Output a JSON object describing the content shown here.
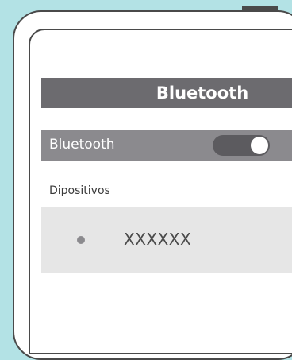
{
  "header": {
    "title": "Bluetooth"
  },
  "bluetooth_row": {
    "label": "Bluetooth",
    "toggle_on": true
  },
  "devices": {
    "section_label": "Dipositivos",
    "items": [
      {
        "name": "XXXXXX"
      }
    ]
  },
  "colors": {
    "background": "#b3e2e5",
    "header": "#6c6b6f",
    "row": "#8b8a8e",
    "device_row": "#e6e6e6",
    "outline": "#4a4a4a"
  }
}
